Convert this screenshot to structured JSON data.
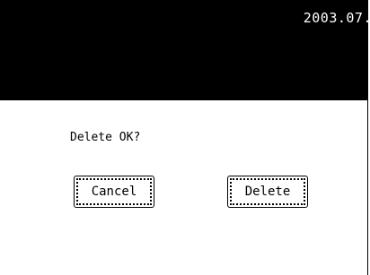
{
  "header": {
    "datetime": "2003.07."
  },
  "dialog": {
    "message": "Delete OK?",
    "cancel_label": "Cancel",
    "delete_label": "Delete"
  },
  "colors": {
    "header_background": "#000000",
    "header_text": "#ffffff",
    "body_background": "#ffffff",
    "text": "#000000"
  }
}
